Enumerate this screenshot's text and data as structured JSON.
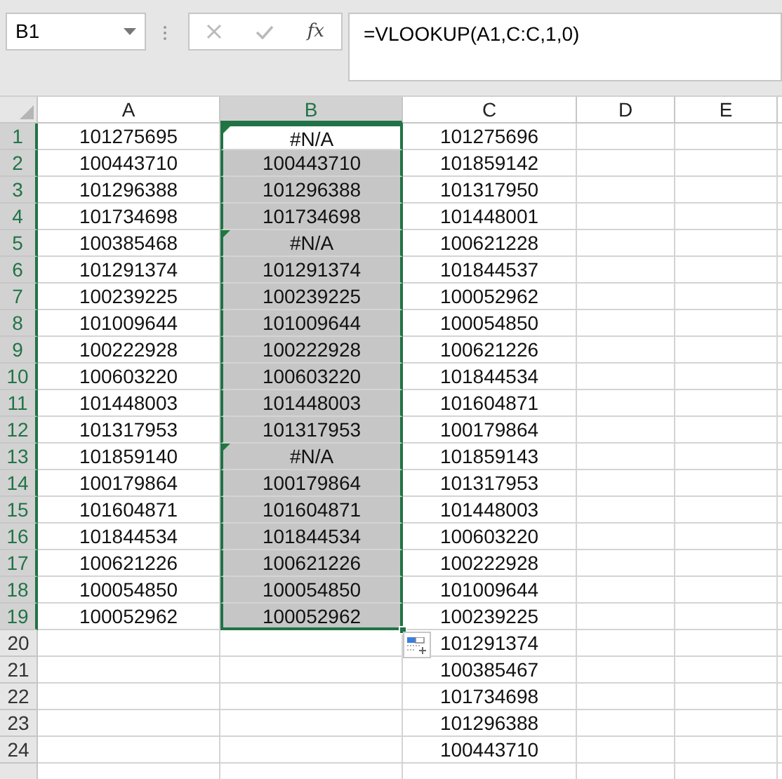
{
  "name_box": {
    "value": "B1"
  },
  "formula_bar": {
    "function_label": "fx",
    "value": "=VLOOKUP(A1,C:C,1,0)"
  },
  "columns": [
    {
      "label": "A",
      "selected": false
    },
    {
      "label": "B",
      "selected": true
    },
    {
      "label": "C",
      "selected": false
    },
    {
      "label": "D",
      "selected": false
    },
    {
      "label": "E",
      "selected": false
    }
  ],
  "rows": [
    {
      "number": "1",
      "selected": true,
      "a": "101275695",
      "b": {
        "text": "#N/A",
        "selected": true,
        "active": true,
        "flagged": true
      },
      "c": "101275696"
    },
    {
      "number": "2",
      "selected": true,
      "a": "100443710",
      "b": {
        "text": "100443710",
        "selected": true,
        "active": false,
        "flagged": false
      },
      "c": "101859142"
    },
    {
      "number": "3",
      "selected": true,
      "a": "101296388",
      "b": {
        "text": "101296388",
        "selected": true,
        "active": false,
        "flagged": false
      },
      "c": "101317950"
    },
    {
      "number": "4",
      "selected": true,
      "a": "101734698",
      "b": {
        "text": "101734698",
        "selected": true,
        "active": false,
        "flagged": false
      },
      "c": "101448001"
    },
    {
      "number": "5",
      "selected": true,
      "a": "100385468",
      "b": {
        "text": "#N/A",
        "selected": true,
        "active": false,
        "flagged": true
      },
      "c": "100621228"
    },
    {
      "number": "6",
      "selected": true,
      "a": "101291374",
      "b": {
        "text": "101291374",
        "selected": true,
        "active": false,
        "flagged": false
      },
      "c": "101844537"
    },
    {
      "number": "7",
      "selected": true,
      "a": "100239225",
      "b": {
        "text": "100239225",
        "selected": true,
        "active": false,
        "flagged": false
      },
      "c": "100052962"
    },
    {
      "number": "8",
      "selected": true,
      "a": "101009644",
      "b": {
        "text": "101009644",
        "selected": true,
        "active": false,
        "flagged": false
      },
      "c": "100054850"
    },
    {
      "number": "9",
      "selected": true,
      "a": "100222928",
      "b": {
        "text": "100222928",
        "selected": true,
        "active": false,
        "flagged": false
      },
      "c": "100621226"
    },
    {
      "number": "10",
      "selected": true,
      "a": "100603220",
      "b": {
        "text": "100603220",
        "selected": true,
        "active": false,
        "flagged": false
      },
      "c": "101844534"
    },
    {
      "number": "11",
      "selected": true,
      "a": "101448003",
      "b": {
        "text": "101448003",
        "selected": true,
        "active": false,
        "flagged": false
      },
      "c": "101604871"
    },
    {
      "number": "12",
      "selected": true,
      "a": "101317953",
      "b": {
        "text": "101317953",
        "selected": true,
        "active": false,
        "flagged": false
      },
      "c": "100179864"
    },
    {
      "number": "13",
      "selected": true,
      "a": "101859140",
      "b": {
        "text": "#N/A",
        "selected": true,
        "active": false,
        "flagged": true
      },
      "c": "101859143"
    },
    {
      "number": "14",
      "selected": true,
      "a": "100179864",
      "b": {
        "text": "100179864",
        "selected": true,
        "active": false,
        "flagged": false
      },
      "c": "101317953"
    },
    {
      "number": "15",
      "selected": true,
      "a": "101604871",
      "b": {
        "text": "101604871",
        "selected": true,
        "active": false,
        "flagged": false
      },
      "c": "101448003"
    },
    {
      "number": "16",
      "selected": true,
      "a": "101844534",
      "b": {
        "text": "101844534",
        "selected": true,
        "active": false,
        "flagged": false
      },
      "c": "100603220"
    },
    {
      "number": "17",
      "selected": true,
      "a": "100621226",
      "b": {
        "text": "100621226",
        "selected": true,
        "active": false,
        "flagged": false
      },
      "c": "100222928"
    },
    {
      "number": "18",
      "selected": true,
      "a": "100054850",
      "b": {
        "text": "100054850",
        "selected": true,
        "active": false,
        "flagged": false
      },
      "c": "101009644"
    },
    {
      "number": "19",
      "selected": true,
      "a": "100052962",
      "b": {
        "text": "100052962",
        "selected": true,
        "active": false,
        "flagged": false
      },
      "c": "100239225"
    },
    {
      "number": "20",
      "selected": false,
      "c": "101291374"
    },
    {
      "number": "21",
      "selected": false,
      "c": "100385467"
    },
    {
      "number": "22",
      "selected": false,
      "c": "101734698"
    },
    {
      "number": "23",
      "selected": false,
      "c": "101296388"
    },
    {
      "number": "24",
      "selected": false,
      "c": "100443710"
    }
  ]
}
